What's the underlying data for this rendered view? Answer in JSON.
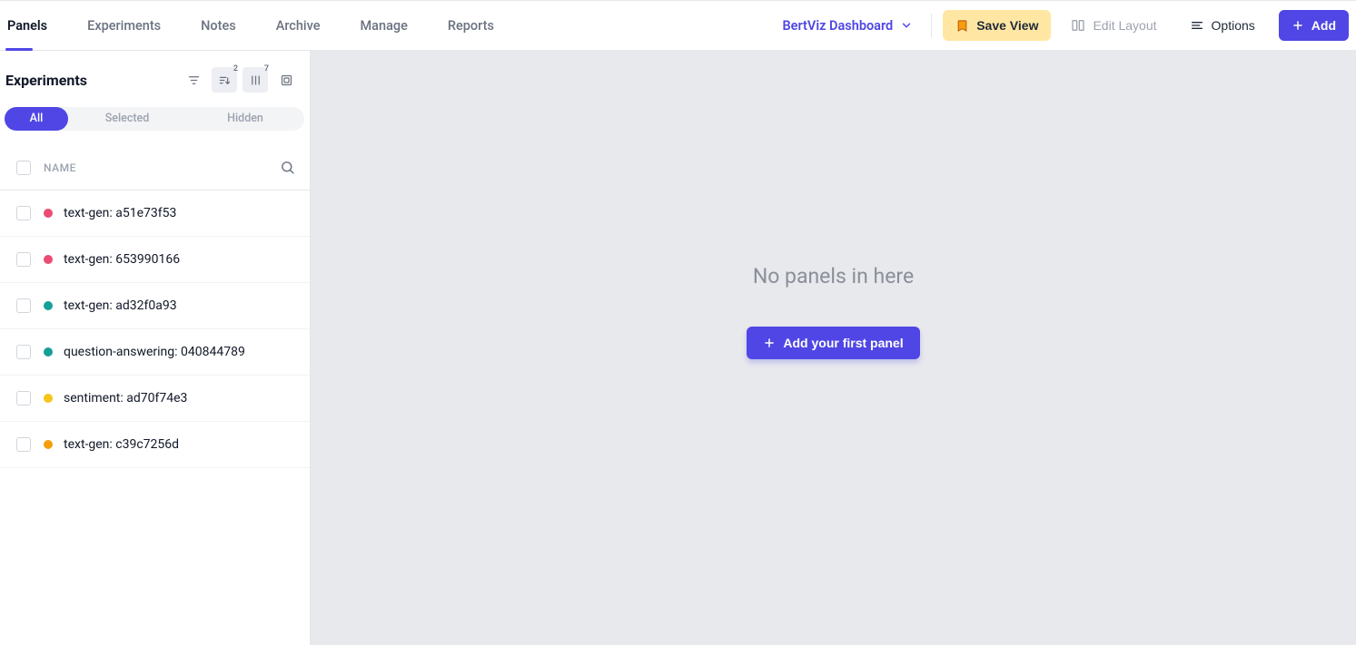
{
  "nav": {
    "tabs": [
      "Panels",
      "Experiments",
      "Notes",
      "Archive",
      "Manage",
      "Reports"
    ],
    "active": 0
  },
  "dashboard": {
    "name": "BertViz Dashboard"
  },
  "toolbar": {
    "save": "Save View",
    "edit": "Edit Layout",
    "options": "Options",
    "add": "Add"
  },
  "sidebar": {
    "title": "Experiments",
    "sort_badge": "2",
    "columns_badge": "7",
    "pills": {
      "all": "All",
      "selected": "Selected",
      "hidden": "Hidden"
    },
    "name_header": "NAME"
  },
  "experiments": [
    {
      "name": "text-gen: a51e73f53",
      "color": "#ec4b72"
    },
    {
      "name": "text-gen: 653990166",
      "color": "#ec4b72"
    },
    {
      "name": "text-gen: ad32f0a93",
      "color": "#14a098"
    },
    {
      "name": "question-answering: 040844789",
      "color": "#14a098"
    },
    {
      "name": "sentiment: ad70f74e3",
      "color": "#f5c518"
    },
    {
      "name": "text-gen: c39c7256d",
      "color": "#f59e0b"
    }
  ],
  "empty": {
    "title": "No panels in here",
    "cta": "Add your first panel"
  }
}
